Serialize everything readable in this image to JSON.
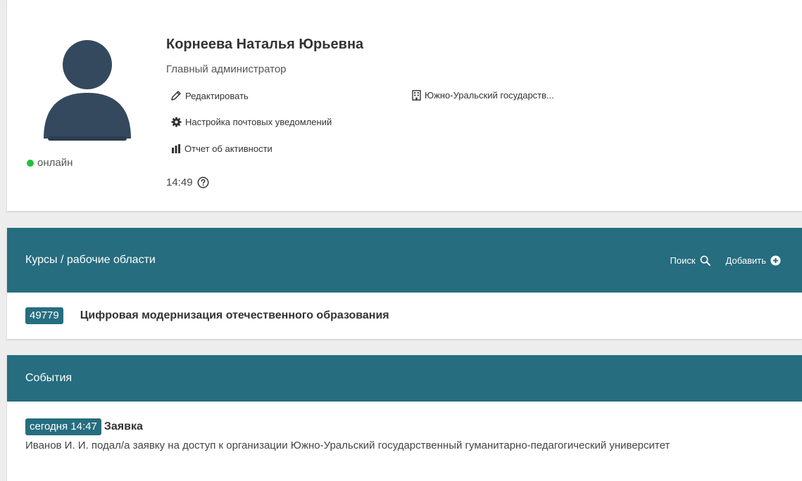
{
  "profile": {
    "name": "Корнеева Наталья Юрьевна",
    "role": "Главный администратор",
    "status": "онлайн",
    "status_color": "#22c13a",
    "links": {
      "edit": "Редактировать",
      "notifications": "Настройка почтовых уведомлений",
      "activity_report": "Отчет об активности",
      "organization": "Южно-Уральский государств..."
    },
    "time": "14:49"
  },
  "courses": {
    "title": "Курсы / рабочие области",
    "search_label": "Поиск",
    "add_label": "Добавить",
    "items": [
      {
        "id": "49779",
        "title": "Цифровая модернизация отечественного образования"
      }
    ]
  },
  "events": {
    "title": "События",
    "items": [
      {
        "time": "сегодня 14:47",
        "type": "Заявка",
        "text": "Иванов И. И. подал/а заявку на доступ к организации Южно-Уральский государственный гуманитарно-педагогический университет"
      }
    ]
  },
  "colors": {
    "accent": "#266d7f",
    "avatar": "#35495e",
    "background": "#ededed"
  },
  "icons": {
    "edit": "pencil-icon",
    "notifications": "gear-icon",
    "activity_report": "bar-chart-icon",
    "organization": "building-icon",
    "time_help": "question-circle-icon",
    "search": "search-icon",
    "add": "plus-circle-icon"
  }
}
